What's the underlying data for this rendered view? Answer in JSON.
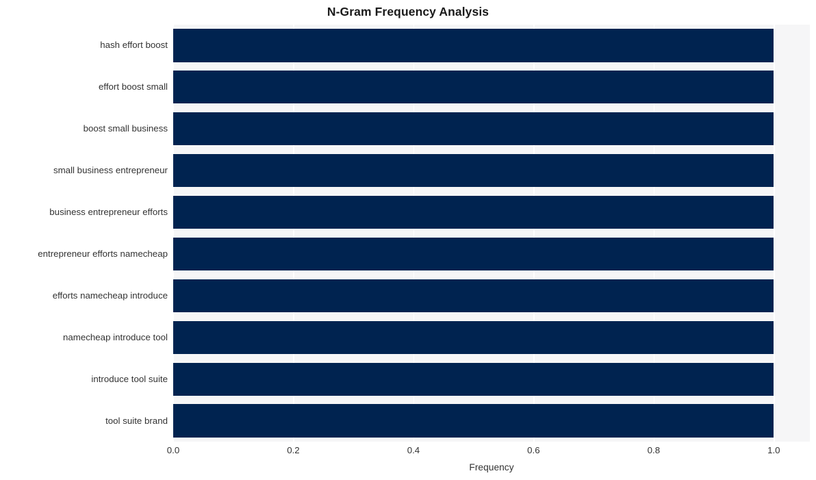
{
  "chart_data": {
    "type": "bar",
    "orientation": "horizontal",
    "title": "N-Gram Frequency Analysis",
    "xlabel": "Frequency",
    "ylabel": "",
    "categories": [
      "hash effort boost",
      "effort boost small",
      "boost small business",
      "small business entrepreneur",
      "business entrepreneur efforts",
      "entrepreneur efforts namecheap",
      "efforts namecheap introduce",
      "namecheap introduce tool",
      "introduce tool suite",
      "tool suite brand"
    ],
    "values": [
      1.0,
      1.0,
      1.0,
      1.0,
      1.0,
      1.0,
      1.0,
      1.0,
      1.0,
      1.0
    ],
    "xlim": [
      0.0,
      1.06
    ],
    "xticks": [
      "0.0",
      "0.2",
      "0.4",
      "0.6",
      "0.8",
      "1.0"
    ],
    "xtick_values": [
      0.0,
      0.2,
      0.4,
      0.6,
      0.8,
      1.0
    ],
    "grid": true,
    "grid_axis": "x",
    "legend": null,
    "bar_color": "#002350",
    "plot_background": "#f6f6f7",
    "grid_color": "#ffffff",
    "figure_background": "#ffffff",
    "text_color": "#333333",
    "title_color": "#1a1a1a"
  }
}
